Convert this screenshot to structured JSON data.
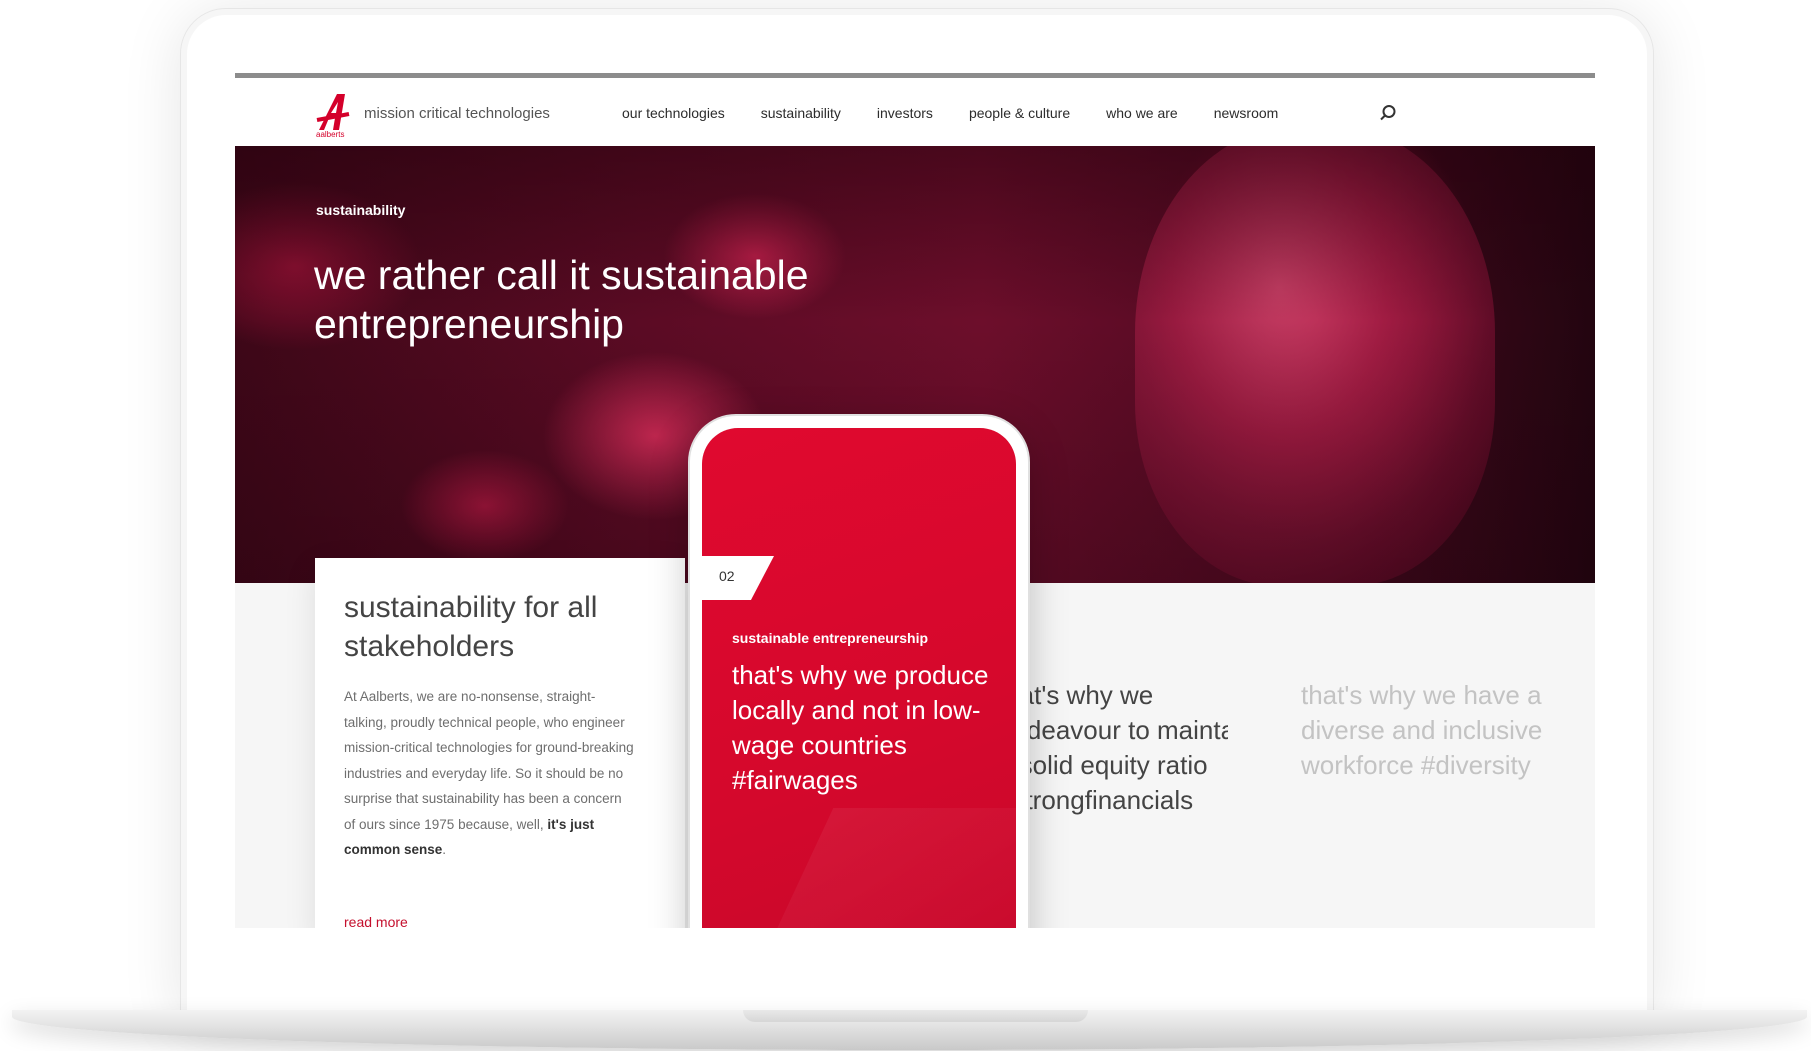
{
  "brand": {
    "logo_text": "aalberts",
    "tagline": "mission critical technologies"
  },
  "nav": {
    "items": [
      {
        "label": "our technologies"
      },
      {
        "label": "sustainability"
      },
      {
        "label": "investors"
      },
      {
        "label": "people & culture"
      },
      {
        "label": "who we are"
      },
      {
        "label": "newsroom"
      }
    ],
    "search_icon": "search-icon"
  },
  "hero": {
    "section_label": "sustainability",
    "title": "we rather call it sustainable entrepreneurship"
  },
  "card": {
    "title": "sustainability for all stakeholders",
    "body_start": "At Aalberts, we are no-nonsense, straight-talking, proudly technical people, who engineer mission-critical technologies for ground-breaking industries and everyday life. So it should be no surprise that sustainability has been a concern of ours since 1975 because, well, ",
    "body_bold": "it's just common sense",
    "body_end": ".",
    "read_more": "read more"
  },
  "slider": {
    "active_number": "02",
    "active_label": "sustainable entrepreneurship",
    "active_quote": "that's why we produce locally and not in low-wage countries #fairwages",
    "next_quote": "that's why we endeavour to maintain a solid equity ratio #strongfinancials",
    "after_quote": "that's why we have a diverse and inclusive workforce #diversity"
  },
  "colors": {
    "brand_red": "#d4002a",
    "phone_red": "#d9082d",
    "hero_tint": "#6d0e2b"
  }
}
